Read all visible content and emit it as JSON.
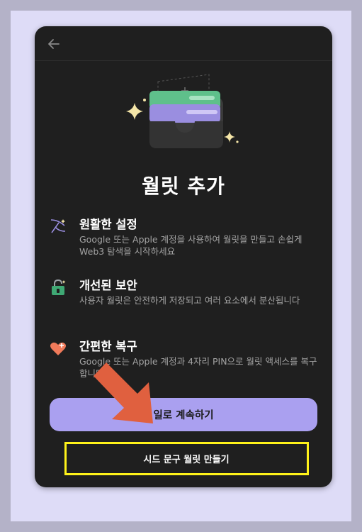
{
  "dialog": {
    "back_icon": "arrow-left-icon",
    "title": "월릿 추가"
  },
  "features": [
    {
      "icon": "sparkle-sling-icon",
      "heading": "원활한 설정",
      "description": "Google 또는 Apple 계정을 사용하여 월릿을 만들고 손쉽게 Web3 탐색을 시작하세요"
    },
    {
      "icon": "padlock-icon",
      "heading": "개선된 보안",
      "description": "사용자 월릿은 안전하게 저장되고 여러 요소에서 분산됩니다"
    },
    {
      "icon": "heart-plus-icon",
      "heading": "간편한 복구",
      "description": "Google 또는 Apple 계정과 4자리 PIN으로 월릿 액세스를 복구합니다"
    }
  ],
  "buttons": {
    "primary_label": "일로 계속하기",
    "secondary_label": "시드 문구 월릿 만들기"
  },
  "colors": {
    "accent": "#aaa0f0",
    "card_bg": "#1f1f1f",
    "highlight": "#fff21a",
    "annotation_arrow": "#e0603f"
  }
}
